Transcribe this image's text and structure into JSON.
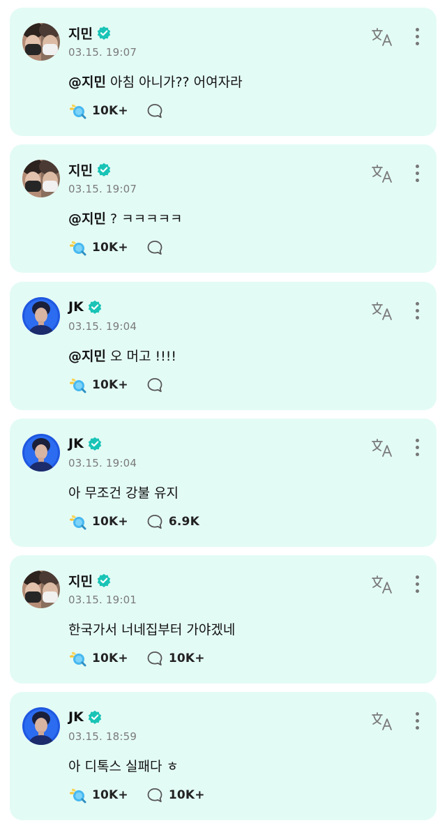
{
  "colors": {
    "card_bg": "#e3fbf5",
    "verified": "#19c4b6",
    "icon": "#7a7a7a"
  },
  "posts": [
    {
      "author": "지민",
      "avatar": "avatar-jimin",
      "time": "03.15. 19:07",
      "mention": "@지민",
      "text": " 아침 아니가?? 어여자라",
      "likes": "10K+",
      "comments": ""
    },
    {
      "author": "지민",
      "avatar": "avatar-jimin",
      "time": "03.15. 19:07",
      "mention": "@지민",
      "text": " ? ㅋㅋㅋㅋㅋ",
      "likes": "10K+",
      "comments": ""
    },
    {
      "author": "JK",
      "avatar": "avatar-jk",
      "time": "03.15. 19:04",
      "mention": "@지민",
      "text": " 오 머고 !!!!",
      "likes": "10K+",
      "comments": ""
    },
    {
      "author": "JK",
      "avatar": "avatar-jk",
      "time": "03.15. 19:04",
      "mention": "",
      "text": "아 무조건 강불 유지",
      "likes": "10K+",
      "comments": "6.9K"
    },
    {
      "author": "지민",
      "avatar": "avatar-jimin",
      "time": "03.15. 19:01",
      "mention": "",
      "text": "한국가서 너네집부터 가야겠네",
      "likes": "10K+",
      "comments": "10K+"
    },
    {
      "author": "JK",
      "avatar": "avatar-jk",
      "time": "03.15. 18:59",
      "mention": "",
      "text": "아 디톡스 실패다 ㅎ",
      "likes": "10K+",
      "comments": "10K+"
    }
  ]
}
